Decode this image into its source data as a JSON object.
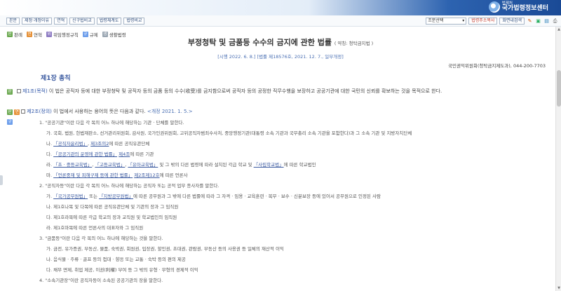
{
  "header": {
    "logo_sub": "법제처",
    "logo_main": "국가법령정보센터"
  },
  "toolbar": {
    "buttons": [
      "본문",
      "제정·개정이유",
      "연혁",
      "신구법비교",
      "법령체계도",
      "법령비교"
    ],
    "select_value": "조문선택",
    "right_buttons": [
      "법령주소복사",
      "화면내검색"
    ]
  },
  "legend": [
    {
      "tag": "판",
      "label": "판례"
    },
    {
      "tag": "연",
      "label": "연혁"
    },
    {
      "tag": "위",
      "label": "위임행정규칙"
    },
    {
      "tag": "규",
      "label": "규제"
    },
    {
      "tag": "생",
      "label": "생활법령"
    }
  ],
  "title": {
    "main": "부정청탁 및 금품등 수수의 금지에 관한 법률",
    "abbr": "( 약칭: 청탁금지법 )"
  },
  "enactment": "[시행 2022. 6. 8.] [법률 제18576호, 2021. 12. 7., 일부개정]",
  "ministry": "국민권익위원회(청탁금지제도과), 044-200-7703",
  "chapter": "제1장 총칙",
  "article1": {
    "head": "제1조(목적)",
    "text": " 이 법은 공직자 등에 대한 부정청탁 및 공직자 등의 금품 등의 수수(收受)를 금지함으로써 공직자 등의 공정한 직무수행을 보장하고 공공기관에 대한 국민의 신뢰를 확보하는 것을 목적으로 한다."
  },
  "article2": {
    "head": "제2조(정의)",
    "text": " 이 법에서 사용하는 용어의 뜻은 다음과 같다. ",
    "amend": "<개정 2021. 1. 5.>"
  },
  "items": {
    "i1": "1. \"공공기관\"이란 다음 각 목의 어느 하나에 해당하는 기관 · 단체를 말한다.",
    "i1a": "가. 국회, 법원, 헌법재판소, 선거관리위원회, 감사원, 국가인권위원회, 고위공직자범죄수사처, 중앙행정기관(대통령 소속 기관과 국무총리 소속 기관을 포함한다)과 그 소속 기관 및 지방자치단체",
    "i1b_pre": "나. ",
    "i1b_link1": "「공직자윤리법」",
    "i1b_link2": "제3조의2",
    "i1b_post": "에 따른 공직유관단체",
    "i1c_pre": "다. ",
    "i1c_link1": "「공공기관의 운영에 관한 법률」",
    "i1c_link2": "제4조",
    "i1c_post": "에 따른 기관",
    "i1d_pre": "라. ",
    "i1d_link1": "「초 · 중등교육법」",
    "i1d_mid1": ", ",
    "i1d_link2": "「고등교육법」",
    "i1d_mid2": ", ",
    "i1d_link3": "「유아교육법」",
    "i1d_mid3": " 및 그 밖의 다른 법령에 따라 설치된 각급 학교 및 ",
    "i1d_link4": "「사립학교법」",
    "i1d_post": "에 따른 학교법인",
    "i1e_pre": "마. ",
    "i1e_link1": "「언론중재 및 피해구제 등에 관한 법률」",
    "i1e_link2": "제2조제12호",
    "i1e_post": "에 따른 언론사",
    "i2": "2. \"공직자등\"이란 다음 각 목의 어느 하나에 해당하는 공직자 또는 공적 업무 종사자를 말한다.",
    "i2a_pre": "가. ",
    "i2a_link1": "「국가공무원법」",
    "i2a_mid": " 또는 ",
    "i2a_link2": "「지방공무원법」",
    "i2a_post": "에 따른 공무원과 그 밖에 다른 법률에 따라 그 자격 · 임용 · 교육훈련 · 복무 · 보수 · 신분보장 등에 있어서 공무원으로 인정된 사람",
    "i2b": "나. 제1호나목 및 다목에 따른 공직유관단체 및 기관의 장과 그 임직원",
    "i2c": "다. 제1호라목에 따른 각급 학교의 장과 교직원 및 학교법인의 임직원",
    "i2d": "라. 제1호마목에 따른 언론사의 대표자와 그 임직원",
    "i3": "3. \"금품등\"이란 다음 각 목의 어느 하나에 해당하는 것을 말한다.",
    "i3a": "가. 금전, 유가증권, 부동산, 물품, 숙박권, 회원권, 입장권, 할인권, 초대권, 관람권, 부동산 등의 사용권 등 일체의 재산적 이익",
    "i3b": "나. 음식물 · 주류 · 골프 등의 접대 · 향응 또는 교통 · 숙박 등의 편의 제공",
    "i3c": "다. 채무 면제, 취업 제공, 이권(利權) 부여 등 그 밖의 유형 · 무형의 경제적 이익",
    "i4": "4. \"소속기관장\"이란 공직자등이 소속된 공공기관의 장을 말한다."
  }
}
